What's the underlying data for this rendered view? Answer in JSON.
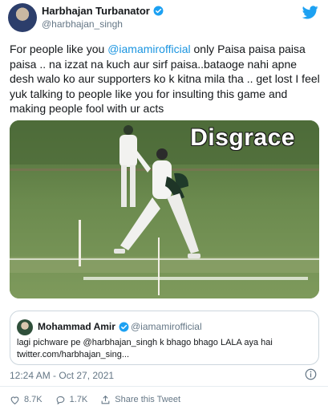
{
  "author": {
    "name": "Harbhajan Turbanator",
    "handle": "@harbhajan_singh"
  },
  "tweet": {
    "text_prefix": "For people like you ",
    "mention": "@iamamirofficial",
    "text_body": " only Paisa paisa paisa paisa .. na izzat na kuch aur sirf paisa..bataoge nahi apne desh walo ko aur supporters ko k kitna mila tha .. get lost I feel yuk talking to people like you for insulting this game and making people fool with ur acts",
    "media_caption": "Disgrace",
    "timestamp": "12:24 AM - Oct 27, 2021"
  },
  "quoted": {
    "name": "Mohammad Amir",
    "handle": "@iamamirofficial",
    "line1": "lagi pichware pe @harbhajan_singh  k bhago bhago LALA aya hai",
    "line2": "twitter.com/harbhajan_sing..."
  },
  "actions": {
    "likes": "8.7K",
    "replies": "1.7K",
    "share_label": "Share this Tweet"
  },
  "icons": {
    "verified": "verified-badge-icon",
    "brand": "twitter-bird-icon",
    "info": "info-icon",
    "like": "heart-icon",
    "reply": "reply-icon",
    "share": "share-icon"
  },
  "colors": {
    "link": "#1b95e0",
    "verified": "#1da1f2",
    "secondary_text": "#657786"
  }
}
